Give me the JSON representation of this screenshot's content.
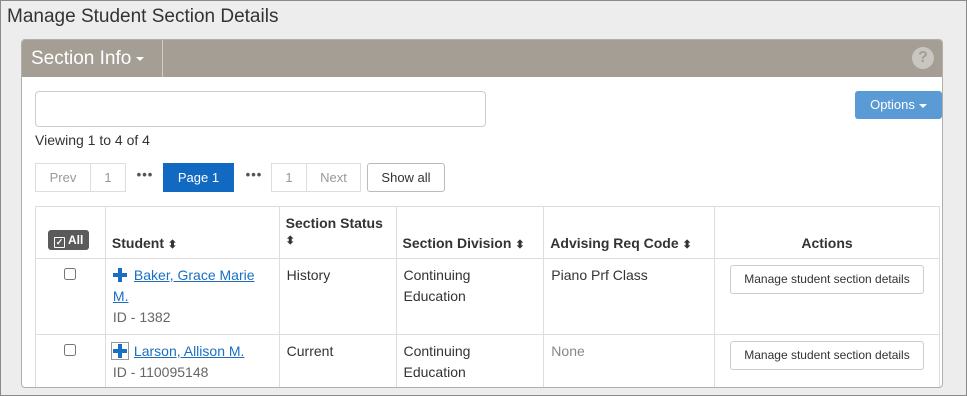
{
  "page": {
    "title": "Manage Student Section Details"
  },
  "panel": {
    "title": "Section Info",
    "help": "?"
  },
  "search": {
    "value": "",
    "placeholder": ""
  },
  "options_label": "Options",
  "viewing_text": "Viewing 1 to 4 of 4",
  "pager": {
    "prev": "Prev",
    "first": "1",
    "dots": "•••",
    "current": "Page 1",
    "last": "1",
    "next": "Next",
    "show_all": "Show all"
  },
  "table": {
    "all_label": "All",
    "columns": {
      "student": "Student",
      "section_status": "Section Status",
      "section_division": "Section Division",
      "advising_req_code": "Advising Req Code",
      "actions": "Actions"
    },
    "sort_icon": "⬍",
    "rows": [
      {
        "name": "Baker, Grace Marie M.",
        "id": "ID - 1382",
        "status": "History",
        "division": "Continuing Education",
        "advising": "Piano Prf Class",
        "action": "Manage student section details"
      },
      {
        "name": "Larson, Allison M.",
        "id": "ID - 110095148",
        "status": "Current",
        "division": "Continuing Education",
        "advising": "None",
        "action": "Manage student section details"
      }
    ]
  },
  "icons": {
    "caret": "caret-down-icon",
    "help": "question-circle-icon",
    "expand": "plus-icon",
    "sort": "sort-icon",
    "select_all": "checkbox-icon"
  },
  "colors": {
    "accent": "#1169c2",
    "header_bg": "#a49e95",
    "options_btn": "#5b9bd5"
  }
}
